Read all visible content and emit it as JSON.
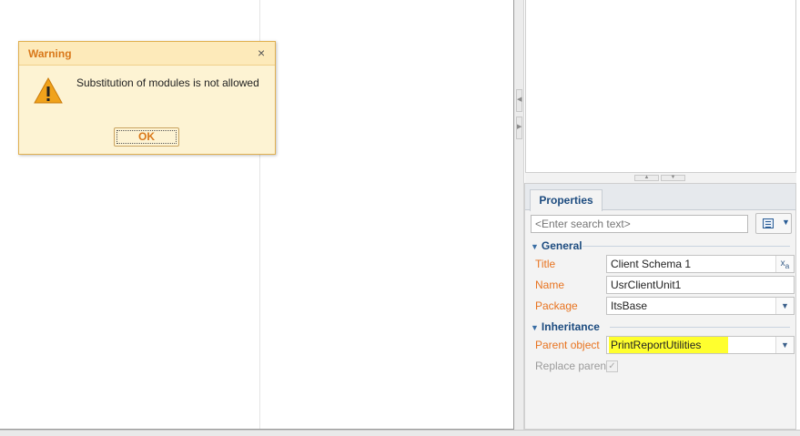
{
  "dialog": {
    "title": "Warning",
    "close_glyph": "×",
    "message": "Substitution of modules is not allowed",
    "ok_label": "OK",
    "icon": "warning-triangle-icon"
  },
  "properties": {
    "tab_label": "Properties",
    "search_placeholder": "<Enter search text>",
    "sections": {
      "general": "General",
      "inheritance": "Inheritance"
    },
    "fields": {
      "title_label": "Title",
      "title_value": "Client Schema 1",
      "name_label": "Name",
      "name_value": "UsrClientUnit1",
      "package_label": "Package",
      "package_value": "ItsBase",
      "parent_label": "Parent object",
      "parent_value": "PrintReportUtilities",
      "replace_label": "Replace parent",
      "replace_checked": true
    }
  },
  "colors": {
    "accent": "#1c4b7f",
    "label": "#e8731f",
    "warning_title": "#d9781a",
    "highlight": "#ffff2e"
  }
}
